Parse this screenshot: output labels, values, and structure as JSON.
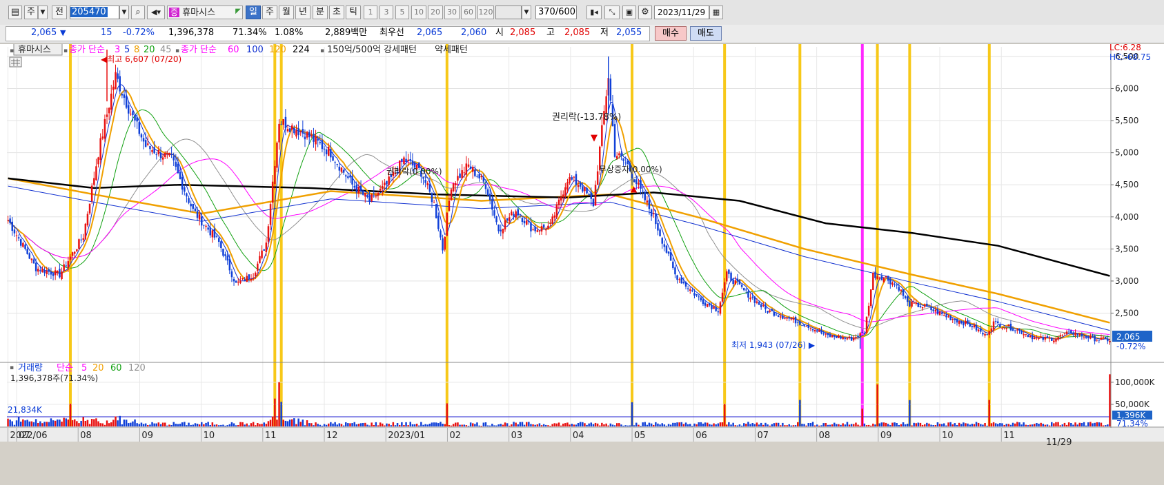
{
  "toolbar": {
    "mode_label": "주",
    "prev_label": "전",
    "code": "205470",
    "stock_badge": "증",
    "stock_name": "휴마시스",
    "periods": [
      "일",
      "주",
      "월",
      "년",
      "분",
      "초",
      "틱"
    ],
    "active_period": "일",
    "intervals": [
      "1",
      "3",
      "5",
      "10",
      "20",
      "30",
      "60",
      "120"
    ],
    "count_value": "370",
    "count_total": "/600",
    "date": "2023/11/29"
  },
  "quote": {
    "price": "2,065",
    "direction_icon": "▼",
    "change": "15",
    "change_pct": "-0.72%",
    "volume": "1,396,378",
    "volume_ratio": "71.34%",
    "turnover": "1.08%",
    "amount": "2,889백만",
    "best_label": "최우선",
    "best_ask": "2,065",
    "best_bid": "2,060",
    "open_label": "시",
    "open": "2,085",
    "high_label": "고",
    "high": "2,085",
    "low_label": "저",
    "low": "2,055",
    "buy_label": "매수",
    "sell_label": "매도"
  },
  "legend": {
    "stock_name": "휴마시스",
    "ma_short_label": "종가 단순",
    "ma_short": [
      {
        "period": "3",
        "color": "#ff00ff"
      },
      {
        "period": "5",
        "color": "#1030d0"
      },
      {
        "period": "8",
        "color": "#f0a000"
      },
      {
        "period": "20",
        "color": "#10a010"
      },
      {
        "period": "45",
        "color": "#909090"
      }
    ],
    "ma_long_label": "종가 단순",
    "ma_long": [
      {
        "period": "60",
        "color": "#ff00ff"
      },
      {
        "period": "100",
        "color": "#1030d0"
      },
      {
        "period": "120",
        "color": "#f0a000"
      },
      {
        "period": "224",
        "color": "#000000"
      }
    ],
    "pattern_label": "150억/500억 강세패턴",
    "weak_label": "약세패턴"
  },
  "annotations": {
    "high_label": "최고 6,607 (07/20)",
    "low_label": "최저 1,943 (07/26)",
    "rights_label": "권리락(-13.78%)",
    "event1_label": "권리락(0.00%)",
    "event2_label": "무상증자(0.00%)",
    "lc_label": "LC:6.28",
    "hc_label": "HC:-68.75"
  },
  "price_axis": {
    "ticks": [
      "6,500",
      "6,000",
      "5,500",
      "5,000",
      "4,500",
      "4,000",
      "3,500",
      "3,000",
      "2,500"
    ],
    "current_price": "2,065",
    "current_pct": "-0.72%"
  },
  "volume_panel": {
    "title": "거래량",
    "ma_label": "단순",
    "ma_periods": [
      {
        "period": "5",
        "color": "#ff00ff"
      },
      {
        "period": "20",
        "color": "#f0a000"
      },
      {
        "period": "60",
        "color": "#10a010"
      },
      {
        "period": "120",
        "color": "#909090"
      }
    ],
    "current_volume": "1,396,378주(71.34%)",
    "level_label": "21,834K",
    "ticks": [
      "100,000K",
      "50,000K"
    ],
    "current_value": "1,396K",
    "current_pct": "71.34%"
  },
  "date_axis": [
    "2022/06",
    "07",
    "08",
    "09",
    "10",
    "11",
    "12",
    "2023/01",
    "02",
    "03",
    "04",
    "05",
    "06",
    "07",
    "08",
    "09",
    "10",
    "11"
  ],
  "date_axis_end": "11/29",
  "chart_data": {
    "type": "candlestick",
    "ylim": [
      1850,
      6650
    ],
    "volume_ylim": [
      0,
      120000
    ],
    "months": [
      "2022/06",
      "07",
      "08",
      "09",
      "10",
      "11",
      "12",
      "2023/01",
      "02",
      "03",
      "04",
      "05",
      "06",
      "07",
      "08",
      "09",
      "10",
      "11"
    ],
    "keypoints": [
      {
        "d": 0,
        "c": 3950
      },
      {
        "d": 13,
        "c": 3200
      },
      {
        "d": 24,
        "c": 3100
      },
      {
        "d": 35,
        "c": 3700
      },
      {
        "d": 42,
        "c": 5000
      },
      {
        "d": 50,
        "c": 6200
      },
      {
        "d": 56,
        "c": 5700
      },
      {
        "d": 64,
        "c": 5100
      },
      {
        "d": 76,
        "c": 4900
      },
      {
        "d": 86,
        "c": 4100
      },
      {
        "d": 98,
        "c": 3600
      },
      {
        "d": 106,
        "c": 2950
      },
      {
        "d": 114,
        "c": 3100
      },
      {
        "d": 120,
        "c": 3600
      },
      {
        "d": 126,
        "c": 5500
      },
      {
        "d": 138,
        "c": 5300
      },
      {
        "d": 150,
        "c": 5000
      },
      {
        "d": 160,
        "c": 4500
      },
      {
        "d": 168,
        "c": 4250
      },
      {
        "d": 176,
        "c": 4500
      },
      {
        "d": 184,
        "c": 4900
      },
      {
        "d": 192,
        "c": 4700
      },
      {
        "d": 198,
        "c": 4200
      },
      {
        "d": 202,
        "c": 3500
      },
      {
        "d": 206,
        "c": 4500
      },
      {
        "d": 214,
        "c": 4800
      },
      {
        "d": 222,
        "c": 4500
      },
      {
        "d": 228,
        "c": 3800
      },
      {
        "d": 236,
        "c": 4100
      },
      {
        "d": 244,
        "c": 3800
      },
      {
        "d": 252,
        "c": 3850
      },
      {
        "d": 260,
        "c": 4600
      },
      {
        "d": 266,
        "c": 4500
      },
      {
        "d": 272,
        "c": 4200
      },
      {
        "d": 279,
        "c": 6200
      },
      {
        "d": 282,
        "c": 5000
      },
      {
        "d": 288,
        "c": 4800
      },
      {
        "d": 294,
        "c": 4400
      },
      {
        "d": 300,
        "c": 4000
      },
      {
        "d": 310,
        "c": 3100
      },
      {
        "d": 322,
        "c": 2700
      },
      {
        "d": 330,
        "c": 2550
      },
      {
        "d": 334,
        "c": 3100
      },
      {
        "d": 342,
        "c": 2850
      },
      {
        "d": 352,
        "c": 2550
      },
      {
        "d": 364,
        "c": 2400
      },
      {
        "d": 372,
        "c": 2300
      },
      {
        "d": 380,
        "c": 2150
      },
      {
        "d": 392,
        "c": 2100
      },
      {
        "d": 398,
        "c": 2200
      },
      {
        "d": 402,
        "c": 3100
      },
      {
        "d": 408,
        "c": 3050
      },
      {
        "d": 414,
        "c": 2900
      },
      {
        "d": 418,
        "c": 2650
      },
      {
        "d": 426,
        "c": 2600
      },
      {
        "d": 436,
        "c": 2450
      },
      {
        "d": 448,
        "c": 2300
      },
      {
        "d": 454,
        "c": 2150
      },
      {
        "d": 458,
        "c": 2350
      },
      {
        "d": 468,
        "c": 2250
      },
      {
        "d": 478,
        "c": 2100
      },
      {
        "d": 486,
        "c": 2100
      },
      {
        "d": 494,
        "c": 2200
      },
      {
        "d": 504,
        "c": 2100
      },
      {
        "d": 512,
        "c": 2080
      }
    ],
    "ma224": [
      {
        "d": 0,
        "v": 4600
      },
      {
        "d": 40,
        "v": 4450
      },
      {
        "d": 80,
        "v": 4500
      },
      {
        "d": 140,
        "v": 4450
      },
      {
        "d": 200,
        "v": 4350
      },
      {
        "d": 260,
        "v": 4300
      },
      {
        "d": 300,
        "v": 4380
      },
      {
        "d": 340,
        "v": 4250
      },
      {
        "d": 380,
        "v": 3900
      },
      {
        "d": 420,
        "v": 3750
      },
      {
        "d": 460,
        "v": 3550
      },
      {
        "d": 512,
        "v": 3080
      }
    ],
    "ma120": [
      {
        "d": 0,
        "v": 4600
      },
      {
        "d": 40,
        "v": 4350
      },
      {
        "d": 90,
        "v": 4050
      },
      {
        "d": 150,
        "v": 4400
      },
      {
        "d": 220,
        "v": 4250
      },
      {
        "d": 280,
        "v": 4350
      },
      {
        "d": 320,
        "v": 4000
      },
      {
        "d": 370,
        "v": 3500
      },
      {
        "d": 420,
        "v": 3100
      },
      {
        "d": 460,
        "v": 2800
      },
      {
        "d": 512,
        "v": 2350
      }
    ],
    "signal_days": [
      29,
      124,
      127,
      204,
      290,
      333,
      368,
      404,
      419,
      456
    ],
    "weak_days": [
      397
    ],
    "high_point": {
      "d": 46,
      "v": 6607,
      "date": "07/20"
    },
    "low_point": {
      "d": 396,
      "v": 1943,
      "date": "07/26"
    },
    "last_close": 2065,
    "last_volume": 1396
  }
}
